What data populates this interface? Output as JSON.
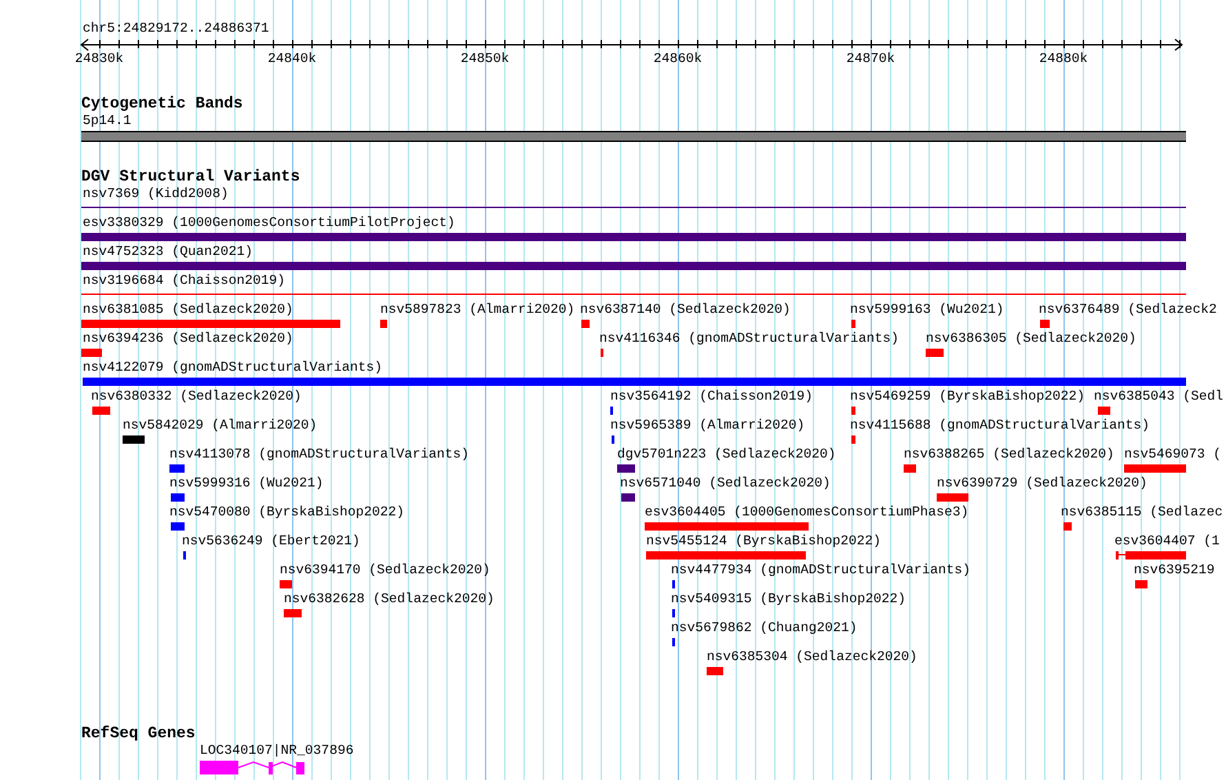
{
  "ruler": {
    "location": "chr5:24829172..24886371",
    "ticks": [
      "24830k",
      "24840k",
      "24850k",
      "24860k",
      "24870k",
      "24880k"
    ]
  },
  "tracks": [
    {
      "kind": "bands",
      "title": "Cytogenetic Bands",
      "band": {
        "label": "5p14.1"
      }
    },
    {
      "kind": "variants",
      "title": "DGV Structural Variants",
      "rows": [
        {
          "features": [
            {
              "label": "nsv7369 (Kidd2008)",
              "kind": "line",
              "color": "#4b0082"
            }
          ]
        },
        {
          "features": [
            {
              "label": "esv3380329 (1000GenomesConsortiumPilotProject)",
              "kind": "bar",
              "color": "#4b0082"
            }
          ]
        },
        {
          "features": [
            {
              "label": "nsv4752323 (Quan2021)",
              "kind": "bar",
              "color": "#4b0082"
            }
          ]
        },
        {
          "features": [
            {
              "label": "nsv3196684 (Chaisson2019)",
              "kind": "line",
              "color": "#ff0000"
            }
          ]
        },
        {
          "features": [
            {
              "label": "nsv6381085 (Sedlazeck2020)",
              "kind": "bar",
              "color": "#ff0000"
            },
            {
              "label": "nsv5897823 (Almarri2020)",
              "kind": "bar",
              "color": "#ff0000"
            },
            {
              "label": "nsv6387140 (Sedlazeck2020)",
              "kind": "bar",
              "color": "#ff0000"
            },
            {
              "label": "nsv5999163 (Wu2021)",
              "kind": "bar",
              "color": "#ff0000"
            },
            {
              "label": "nsv6376489 (Sedlazeck2",
              "kind": "bar",
              "color": "#ff0000"
            }
          ]
        },
        {
          "features": [
            {
              "label": "nsv6394236 (Sedlazeck2020)",
              "kind": "bar",
              "color": "#ff0000"
            },
            {
              "label": "nsv4116346 (gnomADStructuralVariants)",
              "kind": "bar",
              "color": "#ff0000"
            },
            {
              "label": "nsv6386305 (Sedlazeck2020)",
              "kind": "bar",
              "color": "#ff0000"
            }
          ]
        },
        {
          "features": [
            {
              "label": "nsv4122079 (gnomADStructuralVariants)",
              "kind": "bar",
              "color": "#0000ff"
            }
          ]
        },
        {
          "features": [
            {
              "label": "nsv6380332 (Sedlazeck2020)",
              "kind": "bar",
              "color": "#ff0000"
            },
            {
              "label": "nsv3564192 (Chaisson2019)",
              "kind": "bar",
              "color": "#0000ff"
            },
            {
              "label": "nsv5469259 (ByrskaBishop2022)",
              "kind": "bar",
              "color": "#ff0000"
            },
            {
              "label": "nsv6385043 (Sedl",
              "kind": "bar",
              "color": "#ff0000"
            }
          ]
        },
        {
          "features": [
            {
              "label": "nsv5842029 (Almarri2020)",
              "kind": "bar",
              "color": "#000000"
            },
            {
              "label": "nsv5965389 (Almarri2020)",
              "kind": "bar",
              "color": "#0000ff"
            },
            {
              "label": "nsv4115688 (gnomADStructuralVariants)",
              "kind": "bar",
              "color": "#ff0000"
            }
          ]
        },
        {
          "features": [
            {
              "label": "nsv4113078 (gnomADStructuralVariants)",
              "kind": "bar",
              "color": "#0000ff"
            },
            {
              "label": "dgv5701n223 (Sedlazeck2020)",
              "kind": "bar",
              "color": "#4b0082"
            },
            {
              "label": "nsv6388265 (Sedlazeck2020)",
              "kind": "bar",
              "color": "#ff0000"
            },
            {
              "label": "nsv5469073 (",
              "kind": "bar",
              "color": "#ff0000"
            }
          ]
        },
        {
          "features": [
            {
              "label": "nsv5999316 (Wu2021)",
              "kind": "bar",
              "color": "#0000ff"
            },
            {
              "label": "nsv6571040 (Sedlazeck2020)",
              "kind": "bar",
              "color": "#4b0082"
            },
            {
              "label": "nsv6390729 (Sedlazeck2020)",
              "kind": "bar",
              "color": "#ff0000"
            }
          ]
        },
        {
          "features": [
            {
              "label": "nsv5470080 (ByrskaBishop2022)",
              "kind": "bar",
              "color": "#0000ff"
            },
            {
              "label": "esv3604405 (1000GenomesConsortiumPhase3)",
              "kind": "bar",
              "color": "#ff0000"
            },
            {
              "label": "nsv6385115 (Sedlazec",
              "kind": "bar",
              "color": "#ff0000"
            }
          ]
        },
        {
          "features": [
            {
              "label": "nsv5636249 (Ebert2021)",
              "kind": "bar",
              "color": "#0000ff"
            },
            {
              "label": "nsv5455124 (ByrskaBishop2022)",
              "kind": "bar",
              "color": "#ff0000"
            },
            {
              "label": "esv3604407 (1",
              "kind": "whisker",
              "color": "#ff0000"
            }
          ]
        },
        {
          "features": [
            {
              "label": "nsv6394170 (Sedlazeck2020)",
              "kind": "bar",
              "color": "#ff0000"
            },
            {
              "label": "nsv4477934 (gnomADStructuralVariants)",
              "kind": "bar",
              "color": "#0000ff"
            },
            {
              "label": "nsv6395219",
              "kind": "bar",
              "color": "#ff0000"
            }
          ]
        },
        {
          "features": [
            {
              "label": "nsv6382628 (Sedlazeck2020)",
              "kind": "bar",
              "color": "#ff0000"
            },
            {
              "label": "nsv5409315 (ByrskaBishop2022)",
              "kind": "bar",
              "color": "#0000ff"
            }
          ]
        },
        {
          "features": [
            {
              "label": "nsv5679862 (Chuang2021)",
              "kind": "bar",
              "color": "#0000ff"
            }
          ]
        },
        {
          "features": [
            {
              "label": "nsv6385304 (Sedlazeck2020)",
              "kind": "bar",
              "color": "#ff0000"
            }
          ]
        }
      ]
    },
    {
      "kind": "genes",
      "title": "RefSeq Genes",
      "gene": {
        "label": "LOC340107|NR_037896"
      }
    }
  ]
}
